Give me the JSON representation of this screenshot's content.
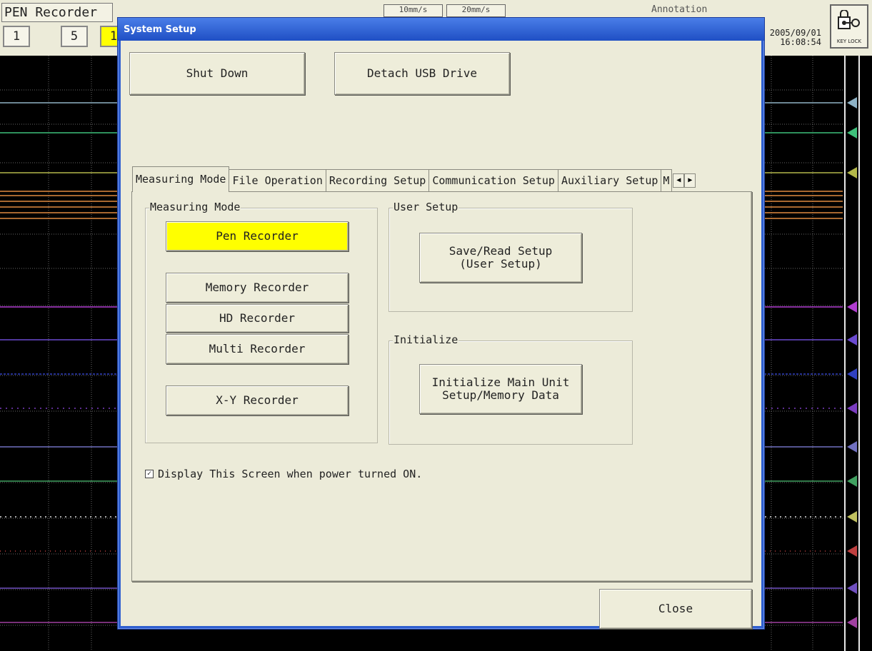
{
  "app": {
    "mode_title": "PEN Recorder",
    "pages": [
      "1",
      "5",
      "1"
    ],
    "speeds": [
      "10mm/s",
      "20mm/s"
    ],
    "annotation_label": "Annotation",
    "date": "2005/09/01",
    "time": "16:08:54",
    "keylock_label": "KEY LOCK"
  },
  "dialog": {
    "title": "System Setup",
    "shutdown_label": "Shut Down",
    "detach_usb_label": "Detach USB Drive",
    "tabs": [
      {
        "label": "Measuring Mode",
        "active": true
      },
      {
        "label": "File Operation"
      },
      {
        "label": "Recording Setup"
      },
      {
        "label": "Communication Setup"
      },
      {
        "label": "Auxiliary Setup"
      },
      {
        "label": "M"
      }
    ],
    "measuring_mode": {
      "group_label": "Measuring Mode",
      "pen_recorder": "Pen Recorder",
      "memory_recorder": "Memory Recorder",
      "hd_recorder": "HD Recorder",
      "multi_recorder": "Multi Recorder",
      "xy_recorder": "X-Y Recorder",
      "selected": "Pen Recorder"
    },
    "user_setup": {
      "group_label": "User Setup",
      "save_read_label": "Save/Read Setup\n(User Setup)"
    },
    "initialize": {
      "group_label": "Initialize",
      "init_label": "Initialize Main Unit\nSetup/Memory Data"
    },
    "startup_checkbox": {
      "checked": true,
      "label": "Display This Screen when power turned ON."
    },
    "close_label": "Close"
  },
  "colors": {
    "selected_mode": "#ffff00",
    "titlebar": "#2f5fd0",
    "panel": "#ecebd9"
  }
}
